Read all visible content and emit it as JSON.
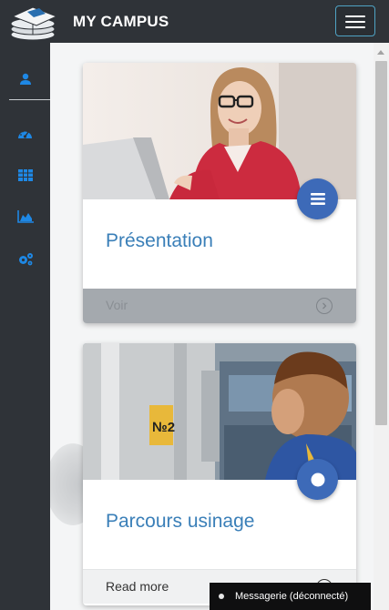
{
  "header": {
    "brand": "MY CAMPUS"
  },
  "sidebar": {
    "items": [
      {
        "icon": "user-icon"
      },
      {
        "icon": "dashboard-icon"
      },
      {
        "icon": "table-icon"
      },
      {
        "icon": "area-chart-icon"
      },
      {
        "icon": "cogs-icon"
      }
    ]
  },
  "cards": [
    {
      "title": "Présentation",
      "footer_label": "Voir",
      "fab_icon": "menu-icon",
      "image": "woman-at-laptop-photo"
    },
    {
      "title": "Parcours usinage",
      "footer_label": "Read more",
      "fab_icon": "circle-icon",
      "image": "machinist-photo"
    }
  ],
  "chat": {
    "label": "Messagerie (déconnecté)"
  },
  "colors": {
    "accent": "#3d6ab8",
    "sidebar_icon": "#1e88e5",
    "title": "#3a7fb8",
    "topbar": "#2f3338"
  }
}
